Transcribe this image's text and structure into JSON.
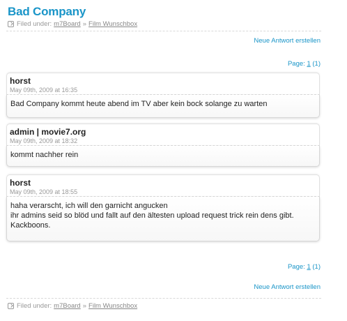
{
  "thread": {
    "title": "Bad Company"
  },
  "breadcrumb": {
    "prefix": "Filed under:",
    "board": "m7Board",
    "separator": "»",
    "forum": "Film Wunschbox"
  },
  "actions": {
    "new_reply": "Neue Antwort erstellen"
  },
  "pagination": {
    "label": "Page:",
    "current": "1",
    "total": "(1)"
  },
  "posts": [
    {
      "author": "horst",
      "date": "May 09th, 2009 at 16:35",
      "lines": [
        "Bad Company kommt heute abend im TV aber kein bock solange zu warten"
      ]
    },
    {
      "author": "admin | movie7.org",
      "date": "May 09th, 2009 at 18:32",
      "lines": [
        "kommt nachher rein"
      ]
    },
    {
      "author": "horst",
      "date": "May 09th, 2009 at 18:55",
      "lines": [
        "haha verarscht, ich will den garnicht angucken",
        "ihr admins seid so blöd und fallt auf den ältesten upload request trick rein dens gibt.",
        "Kackboons."
      ]
    }
  ],
  "colors": {
    "accent": "#1a95c8",
    "muted": "#999999",
    "text": "#222222"
  },
  "icons": {
    "breadcrumb": "arrow-box-icon"
  }
}
